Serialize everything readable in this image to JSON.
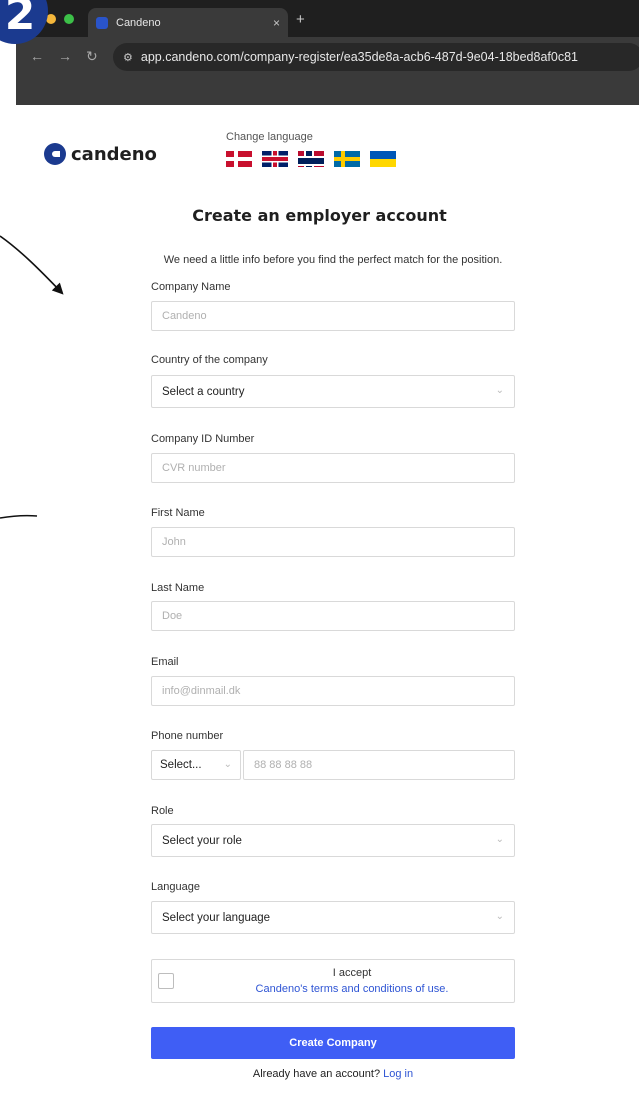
{
  "step_badge": "2",
  "browser": {
    "tab_title": "Candeno",
    "tab_close": "×",
    "new_tab": "+",
    "back": "←",
    "forward": "→",
    "reload": "↻",
    "site_info": "⚙",
    "url": "app.candeno.com/company-register/ea35de8a-acb6-487d-9e04-18bed8af0c81"
  },
  "header": {
    "logo_text": "candeno",
    "change_language": "Change language",
    "flags": [
      "danish-flag-icon",
      "uk-flag-icon",
      "norwegian-flag-icon",
      "swedish-flag-icon",
      "ukrainian-flag-icon"
    ]
  },
  "page": {
    "title": "Create an employer account",
    "subtitle": "We need a little info before you find the perfect match for the position."
  },
  "form": {
    "company_name": {
      "label": "Company Name",
      "placeholder": "Candeno"
    },
    "country": {
      "label": "Country of the company",
      "value": "Select a country"
    },
    "company_id": {
      "label": "Company ID Number",
      "placeholder": "CVR number"
    },
    "first_name": {
      "label": "First Name",
      "placeholder": "John"
    },
    "last_name": {
      "label": "Last Name",
      "placeholder": "Doe"
    },
    "email": {
      "label": "Email",
      "placeholder": "info@dinmail.dk"
    },
    "phone": {
      "label": "Phone number",
      "prefix_value": "Select...",
      "placeholder": "88 88 88 88"
    },
    "role": {
      "label": "Role",
      "value": "Select your role"
    },
    "language": {
      "label": "Language",
      "value": "Select your language"
    },
    "terms": {
      "accept": "I accept",
      "link": "Candeno's terms and conditions of use."
    },
    "submit_label": "Create Company",
    "login_prompt": "Already have an account?",
    "login_link": "Log in"
  },
  "colors": {
    "accent": "#3f5ef5",
    "link": "#2f55d4",
    "brand": "#1b3a8f"
  }
}
